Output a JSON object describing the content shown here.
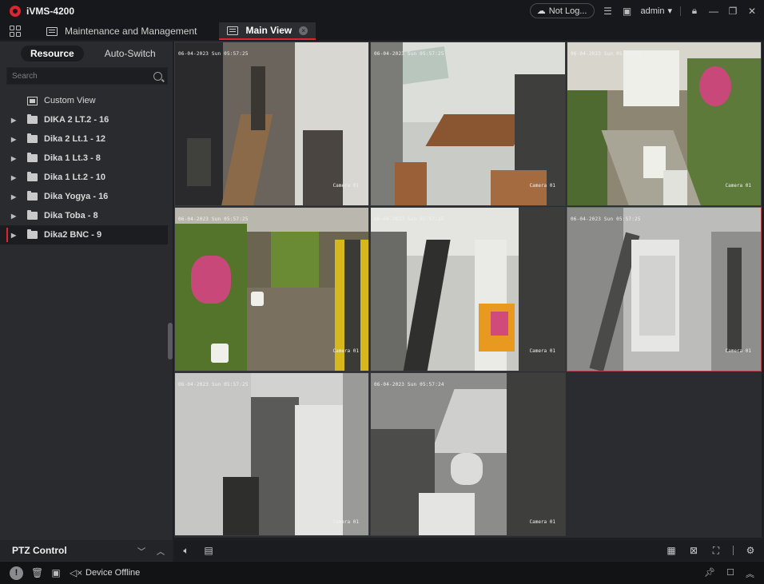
{
  "app": {
    "title": "iVMS-4200"
  },
  "titlebar": {
    "cloud_status": "Not Log...",
    "user": "admin"
  },
  "tabs": [
    {
      "label": "Maintenance and Management"
    },
    {
      "label": "Main View"
    }
  ],
  "left_panel": {
    "segments": [
      "Resource",
      "Auto-Switch"
    ],
    "search_placeholder": "Search",
    "tree": [
      {
        "label": "Custom View"
      },
      {
        "label": "DIKA 2 LT.2 - 16"
      },
      {
        "label": "Dika 2 Lt.1 - 12"
      },
      {
        "label": "Dika 1 Lt.3 - 8"
      },
      {
        "label": "Dika 1 Lt.2 - 10"
      },
      {
        "label": "Dika Yogya - 16"
      },
      {
        "label": "Dika Toba - 8"
      },
      {
        "label": "Dika2 BNC - 9"
      }
    ],
    "ptz_label": "PTZ Control"
  },
  "cameras": [
    {
      "timestamp": "06-04-2023 Sun 05:57:25",
      "name": "Camera 01"
    },
    {
      "timestamp": "06-04-2023 Sun 05:57:25",
      "name": "Camera 01"
    },
    {
      "timestamp": "06-04-2023 Sun 05:57:25",
      "name": "Camera 01"
    },
    {
      "timestamp": "06-04-2023 Sun 05:57:25",
      "name": "Camera 01"
    },
    {
      "timestamp": "06-04-2023 Sun 05:57:25",
      "name": "Camera 01"
    },
    {
      "timestamp": "06-04-2023 Sun 05:57:25",
      "name": "Camera 01"
    },
    {
      "timestamp": "06-04-2023 Sun 05:57:25",
      "name": "Camera 01"
    },
    {
      "timestamp": "06-04-2023 Sun 05:57:24",
      "name": "Camera 01"
    }
  ],
  "statusbar": {
    "text": "Device Offline"
  },
  "colors": {
    "accent": "#e0242f",
    "selected_cell": "#b5454d"
  }
}
